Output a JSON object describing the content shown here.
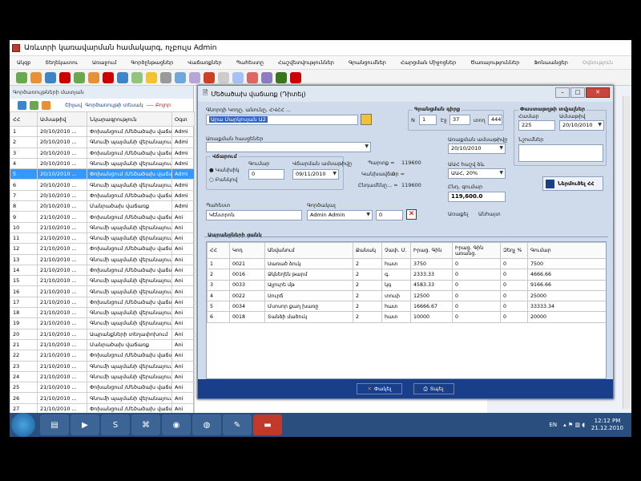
{
  "app": {
    "title": "Առևտրի կառավարման համակարգ, ոչբուլս Admin"
  },
  "menu": [
    "Ակզբ",
    "Տեղեկատու",
    "Առաջում",
    "Գործընթացներ",
    "Վաճառքներ",
    "Պահեստը",
    "Հաշվետվություններ",
    "Գրանցումներ",
    "Հարցման Միջոցներ",
    "Ծառայություններ",
    "Ֆոնաանցեր",
    "Օգնություն"
  ],
  "bg": {
    "title": "Գործառույթների մատյան",
    "toolbar": [
      "Շիլավ",
      "Գործառույթի տեսակ",
      "---- Բոլոր"
    ],
    "columns": [
      "ՀՀ",
      "Ամսաթիվ",
      "Նկարագրություն",
      "Օգտ"
    ],
    "rows": [
      [
        "1",
        "20/10/2010 ...",
        "Փոխանցում /Մեծածախ վաճառք/",
        "Admi"
      ],
      [
        "2",
        "20/10/2010 ...",
        "Գնումի պայմանի վերանայում",
        "Admi"
      ],
      [
        "3",
        "20/10/2010 ...",
        "Փոխանցում /Մեծածախ վաճառք/",
        "Admi"
      ],
      [
        "4",
        "20/10/2010 ...",
        "Գնումի պայմանի վերանայում",
        "Admi"
      ],
      [
        "5",
        "20/10/2010 ...",
        "Փոխանցում /Մեծածախ վաճառք/",
        "Admi"
      ],
      [
        "6",
        "20/10/2010 ...",
        "Գնումի պայմանի վերանայում",
        "Admi"
      ],
      [
        "7",
        "20/10/2010 ...",
        "Փոխանցում /Մեծածախ վաճառք/",
        "Admi"
      ],
      [
        "8",
        "20/10/2010 ...",
        "Մանրածախ վաճառք",
        "Admi"
      ],
      [
        "9",
        "21/10/2010 ...",
        "Փոխանցում /Մեծածախ վաճառք/",
        "Ani"
      ],
      [
        "10",
        "21/10/2010 ...",
        "Գնումի պայմանի վերանայում",
        "Ani"
      ],
      [
        "11",
        "21/10/2010 ...",
        "Գնումի պայմանի վերանայում",
        "Ani"
      ],
      [
        "12",
        "21/10/2010 ...",
        "Փոխանցում /Մեծածախ վաճառք/",
        "Ani"
      ],
      [
        "13",
        "21/10/2010 ...",
        "Գնումի պայմանի վերանայում",
        "Ani"
      ],
      [
        "14",
        "21/10/2010 ...",
        "Փոխանցում /Մեծածախ վաճառք/",
        "Ani"
      ],
      [
        "15",
        "21/10/2010 ...",
        "Գնումի պայմանի վերանայում",
        "Ani"
      ],
      [
        "16",
        "21/10/2010 ...",
        "Գնումի պայմանի վերանայում",
        "Ani"
      ],
      [
        "17",
        "21/10/2010 ...",
        "Փոխանցում /Մեծածախ վաճառք/",
        "Ani"
      ],
      [
        "18",
        "21/10/2010 ...",
        "Գնումի պայմանի վերանայում",
        "Ani"
      ],
      [
        "19",
        "21/10/2010 ...",
        "Գնումի պայմանի վերանայում",
        "Ani"
      ],
      [
        "20",
        "21/10/2010 ...",
        "Ապրանքների տեղափոխում",
        "Ani"
      ],
      [
        "21",
        "21/10/2010 ...",
        "Մանրածախ վաճառք",
        "Ani"
      ],
      [
        "22",
        "21/10/2010 ...",
        "Փոխանցում /Մեծածախ վաճառք/",
        "Ani"
      ],
      [
        "23",
        "21/10/2010 ...",
        "Գնումի պայմանի վերանայում",
        "Ani"
      ],
      [
        "24",
        "21/10/2010 ...",
        "Գնումի պայմանի վերանայում",
        "Ani"
      ],
      [
        "25",
        "21/10/2010 ...",
        "Փոխանցում /Մեծածախ վաճառք/",
        "Ani"
      ],
      [
        "26",
        "21/10/2010 ...",
        "Գնումի պայմանի վերանայում",
        "Ani"
      ],
      [
        "27",
        "21/10/2010 ...",
        "Փոխանցում /Մեծածախ վաճառք/",
        "Ani"
      ],
      [
        "28",
        "21/10/2010 ...",
        "Գնումի պայմանի վերանայում",
        "Ani"
      ],
      [
        "29",
        "21/10/2010 ...",
        "Փոխանցում /Մեծածախ վաճառք/",
        "Ani"
      ]
    ]
  },
  "dialog": {
    "title": "Մեծածախ վաճառք (Դիտել)",
    "customer_label": "Գնորդի Կոդը, անունը, ՀՎՀՀ ...",
    "customer_value": "Արա Մարկոսյան Ա2",
    "payer_label": "Առաքման հասցեներ",
    "paytype_label": "Վճարում",
    "cash": "Կանխիկ",
    "noncash": "Բանկով",
    "amount_label": "Գումար",
    "amount_value": "0",
    "paydate_label": "Վճարման ամսաթիվը",
    "paydate_value": "09/11/2010",
    "debt_label": "Պարտք =",
    "debt_value": "119600",
    "prepaid_label": "Կանխավճար =",
    "prepaid_value": "0",
    "total2_label": "Ընդամենը... =",
    "total2_value": "119600",
    "invoice_group": "Գրանցման գիրք",
    "n_label": "N",
    "n_value": "1",
    "page_label": "Էջ",
    "page_value": "37",
    "rownum_label": "տող",
    "rownum_value": "444",
    "shipdate_label": "Առաքման ամսաթիվը",
    "shipdate_value": "20/10/2010",
    "vat_label": "ԱԱՀ հաշվ ձև",
    "vat_value": "ԱԱՀ, 20%",
    "total_label": "Ընդ. գումար",
    "total_value": "119,600.0",
    "warehouse_label": "Պահեստ",
    "warehouse_value": "Կենտրոն",
    "user_label": "Գործակալ",
    "user_value": "Admin Admin",
    "discount_value": "0",
    "status_label": "Առաքել",
    "status_value": "Անհայտ",
    "doc_group": "Փաստաթղթի տվյալներ",
    "doc_num_label": "Համար",
    "doc_num_value": "225",
    "doc_date_label": "Ամսաթիվ",
    "doc_date_value": "20/10/2010",
    "comment_label": "Նշումներ",
    "print_btn": "Ներմուծել ՀՀ",
    "items_label": "Ապրանքների ցանկ",
    "columns": [
      "ՀՀ",
      "Կոդ",
      "Անվանում",
      "Քանակ",
      "Չափ. Մ.",
      "Իրաց. Գին",
      "Իրաց. Գին առանց.",
      "Զեղչ %",
      "Գումար"
    ],
    "items": [
      [
        "1",
        "0021",
        "Սառած ձուկ",
        "2",
        "հատ",
        "3750",
        "0",
        "0",
        "7500"
      ],
      [
        "2",
        "0016",
        "Ձկնեղեն թարմ",
        "2",
        "գ.",
        "2333.33",
        "0",
        "0",
        "4666.66"
      ],
      [
        "3",
        "0033",
        "Ալյուրե մթ",
        "2",
        "կգ",
        "4583.33",
        "0",
        "0",
        "9166.66"
      ],
      [
        "4",
        "0022",
        "Սուրճ",
        "2",
        "տուփ",
        "12500",
        "0",
        "0",
        "25000"
      ],
      [
        "5",
        "0034",
        "Մսոսոր քաղ խառը",
        "2",
        "հատ",
        "16666.67",
        "0",
        "0",
        "33333.34"
      ],
      [
        "6",
        "0018",
        "Տանձի մածուկ",
        "2",
        "հատ",
        "10000",
        "0",
        "0",
        "20000"
      ]
    ],
    "cancel_btn": "Փակել",
    "print2_btn": "Տպել"
  },
  "taskbar": {
    "lang": "EN",
    "time": "12:12 PM",
    "date": "21.12.2010"
  }
}
